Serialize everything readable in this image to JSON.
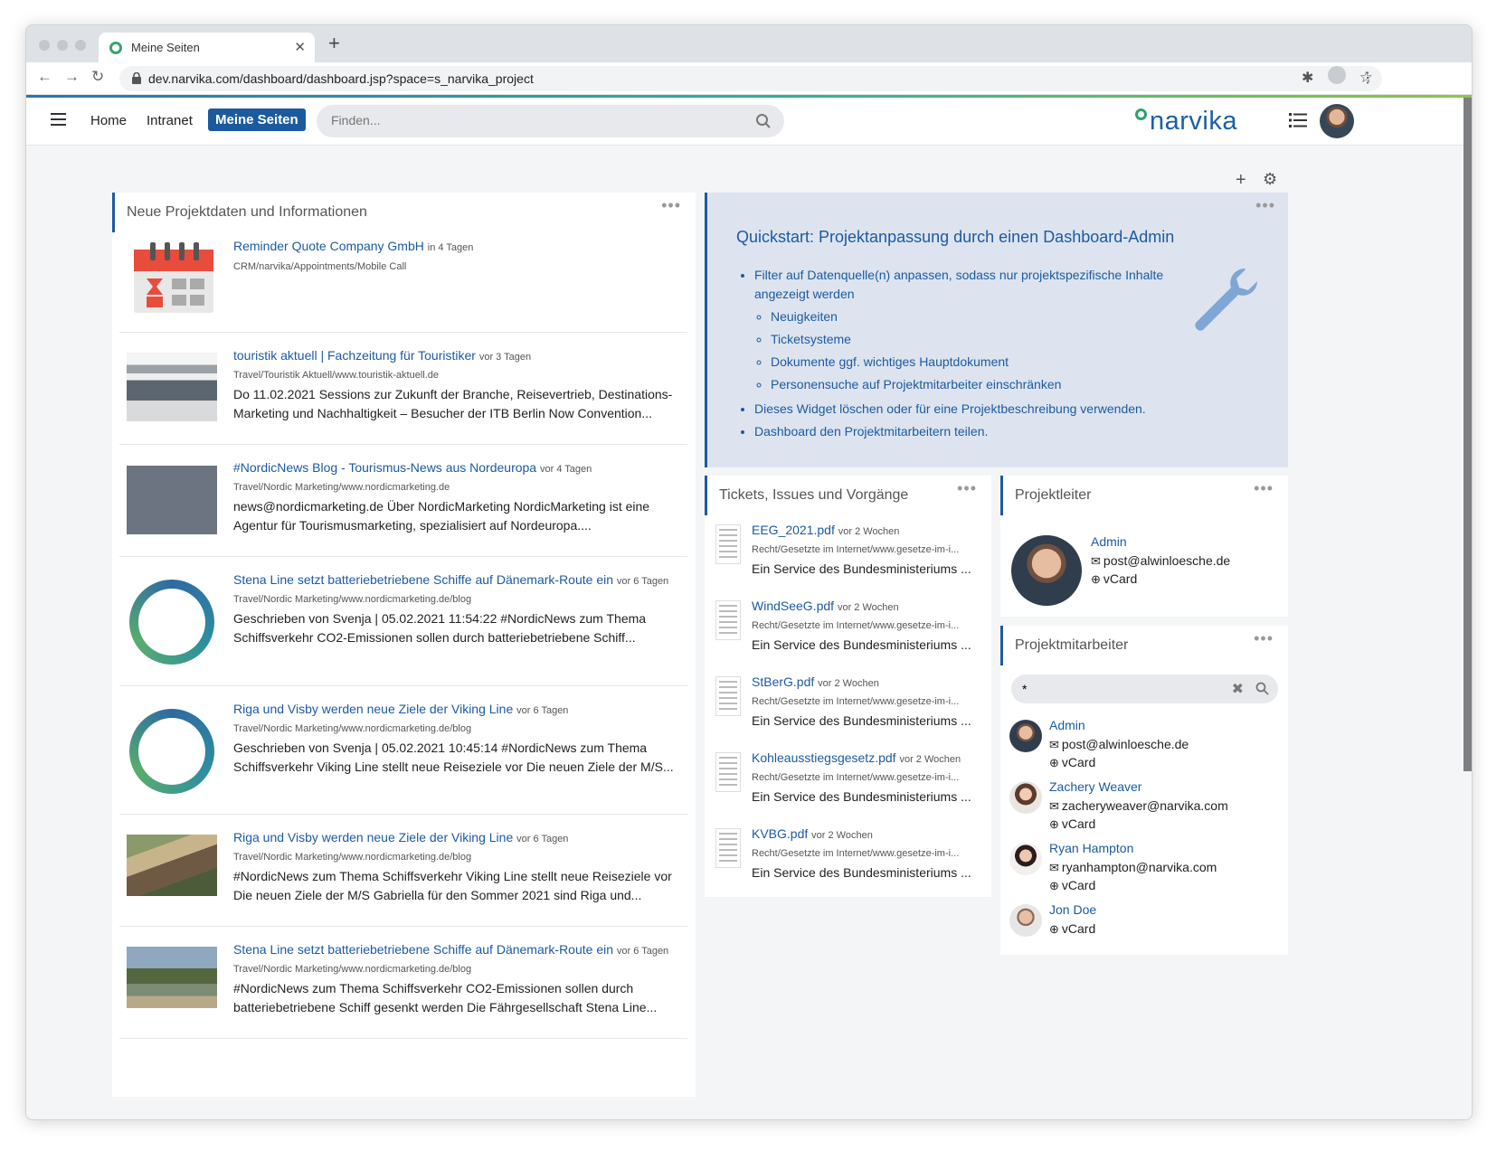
{
  "browser": {
    "tab_title": "Meine Seiten",
    "url": "dev.narvika.com/dashboard/dashboard.jsp?space=s_narvika_project"
  },
  "header": {
    "nav": [
      "Home",
      "Intranet",
      "Meine Seiten"
    ],
    "search_placeholder": "Finden...",
    "logo": "narvika"
  },
  "news": {
    "title": "Neue Projektdaten und Informationen",
    "items": [
      {
        "title": "Reminder Quote Company GmbH",
        "ago": "in 4 Tagen",
        "path": "CRM/narvika/Appointments/Mobile Call",
        "text": ""
      },
      {
        "title": "touristik aktuell | Fachzeitung für Touristiker",
        "ago": "vor 3 Tagen",
        "path": "Travel/Touristik Aktuell/www.touristik-aktuell.de",
        "text": "Do 11.02.2021 Sessions zur Zukunft der Branche, Reisevertrieb, Destinations-Marketing und Nachhaltigkeit – Besucher der ITB Berlin Now Convention..."
      },
      {
        "title": "#NordicNews Blog - Tourismus-News aus Nordeuropa",
        "ago": "vor 4 Tagen",
        "path": "Travel/Nordic Marketing/www.nordicmarketing.de",
        "text": "news@nordicmarketing.de Über NordicMarketing NordicMarketing ist eine Agentur für Tourismusmarketing, spezialisiert auf Nordeuropa...."
      },
      {
        "title": "Stena Line setzt batteriebetriebene Schiffe auf Dänemark-Route ein",
        "ago": "vor 6 Tagen",
        "path": "Travel/Nordic Marketing/www.nordicmarketing.de/blog",
        "text": "Geschrieben von Svenja | 05.02.2021 11:54:22 #NordicNews zum Thema Schiffsverkehr CO2-Emissionen sollen durch batteriebetriebene Schiff..."
      },
      {
        "title": "Riga und Visby werden neue Ziele der Viking Line",
        "ago": "vor 6 Tagen",
        "path": "Travel/Nordic Marketing/www.nordicmarketing.de/blog",
        "text": "Geschrieben von Svenja | 05.02.2021 10:45:14 #NordicNews zum Thema Schiffsverkehr Viking Line stellt neue Reiseziele vor Die neuen Ziele der M/S..."
      },
      {
        "title": "Riga und Visby werden neue Ziele der Viking Line",
        "ago": "vor 6 Tagen",
        "path": "Travel/Nordic Marketing/www.nordicmarketing.de/blog",
        "text": "#NordicNews zum Thema Schiffsverkehr Viking Line stellt neue Reiseziele vor Die neuen Ziele der M/S Gabriella für den Sommer 2021 sind Riga und..."
      },
      {
        "title": "Stena Line setzt batteriebetriebene Schiffe auf Dänemark-Route ein",
        "ago": "vor 6 Tagen",
        "path": "Travel/Nordic Marketing/www.nordicmarketing.de/blog",
        "text": "#NordicNews zum Thema Schiffsverkehr CO2-Emissionen sollen durch batteriebetriebene Schiff gesenkt werden Die Fährgesellschaft Stena Line..."
      }
    ]
  },
  "quickstart": {
    "title": "Quickstart: Projektanpassung durch einen Dashboard-Admin",
    "item1": "Filter auf Datenquelle(n) anpassen, sodass nur projektspezifische Inhalte angezeigt werden",
    "sub": [
      "Neuigkeiten",
      "Ticketsysteme",
      "Dokumente ggf. wichtiges Hauptdokument",
      "Personensuche auf Projektmitarbeiter einschränken"
    ],
    "item2": "Dieses Widget löschen oder für eine Projektbeschreibung verwenden.",
    "item3": "Dashboard den Projektmitarbeitern teilen."
  },
  "tickets": {
    "title": "Tickets, Issues und Vorgänge",
    "items": [
      {
        "name": "EEG_2021.pdf",
        "ago": "vor 2 Wochen",
        "path": "Recht/Gesetzte im Internet/www.gesetze-im-i...",
        "text": "Ein Service des Bundesministeriums ..."
      },
      {
        "name": "WindSeeG.pdf",
        "ago": "vor 2 Wochen",
        "path": "Recht/Gesetzte im Internet/www.gesetze-im-i...",
        "text": "Ein Service des Bundesministeriums ..."
      },
      {
        "name": "StBerG.pdf",
        "ago": "vor 2 Wochen",
        "path": "Recht/Gesetzte im Internet/www.gesetze-im-i...",
        "text": "Ein Service des Bundesministeriums ..."
      },
      {
        "name": "Kohleausstiegsgesetz.pdf",
        "ago": "vor 2 Wochen",
        "path": "Recht/Gesetzte im Internet/www.gesetze-im-i...",
        "text": "Ein Service des Bundesministeriums ..."
      },
      {
        "name": "KVBG.pdf",
        "ago": "vor 2 Wochen",
        "path": "Recht/Gesetzte im Internet/www.gesetze-im-i...",
        "text": "Ein Service des Bundesministeriums ..."
      }
    ]
  },
  "lead": {
    "title": "Projektleiter",
    "name": "Admin",
    "email": "post@alwinloesche.de",
    "vcard": "vCard"
  },
  "team": {
    "title": "Projektmitarbeiter",
    "search_value": "*",
    "members": [
      {
        "name": "Admin",
        "email": "post@alwinloesche.de",
        "vcard": "vCard"
      },
      {
        "name": "Zachery Weaver",
        "email": "zacheryweaver@narvika.com",
        "vcard": "vCard"
      },
      {
        "name": "Ryan Hampton",
        "email": "ryanhampton@narvika.com",
        "vcard": "vCard"
      },
      {
        "name": "Jon Doe",
        "email": "",
        "vcard": "vCard"
      }
    ]
  },
  "colors": {
    "accent": "#1c5aa0",
    "quickstart_bg": "#dde4ef",
    "logo_ring": "#2ba36a"
  }
}
